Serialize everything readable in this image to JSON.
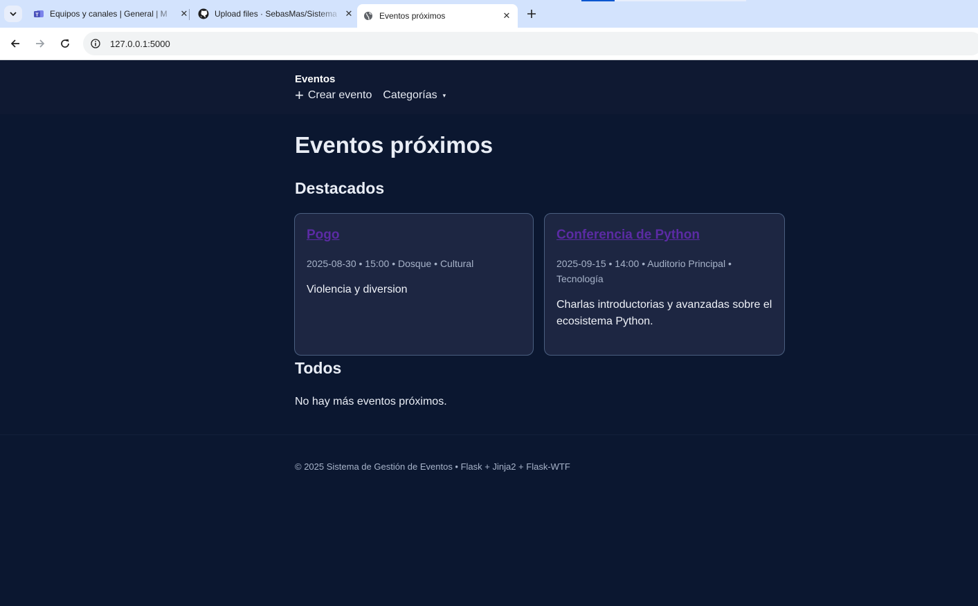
{
  "browser": {
    "tabs": [
      {
        "title": "Equipos y canales | General | M",
        "favicon": "teams-icon"
      },
      {
        "title": "Upload files · SebasMas/Sistema",
        "favicon": "github-icon"
      },
      {
        "title": "Eventos próximos",
        "favicon": "globe-icon",
        "active": true
      }
    ],
    "url": "127.0.0.1:5000"
  },
  "header": {
    "brand": "Eventos",
    "nav": {
      "create_plus": "+",
      "create": "Crear evento",
      "categories": "Categorías",
      "caret": "▾"
    }
  },
  "main": {
    "title": "Eventos próximos",
    "featured_heading": "Destacados",
    "featured": [
      {
        "title": "Pogo",
        "meta": "2025-08-30 • 15:00 • Dosque • Cultural",
        "description": "Violencia y diversion"
      },
      {
        "title": "Conferencia de Python",
        "meta": "2025-09-15 • 14:00 • Auditorio Principal • Tecnología",
        "description": "Charlas introductorias y avanzadas sobre el ecosistema Python."
      }
    ],
    "all_heading": "Todos",
    "empty_message": "No hay más eventos próximos."
  },
  "footer": {
    "text": "© 2025 Sistema de Gestión de Eventos • Flask + Jinja2 + Flask-WTF"
  },
  "colors": {
    "page_bg": "#0b1730",
    "header_bg": "#0f1932",
    "card_bg": "#1d2642",
    "card_border": "#4a5f80",
    "link_visited": "#5b2ba4",
    "muted_text": "#a7b3c9"
  }
}
